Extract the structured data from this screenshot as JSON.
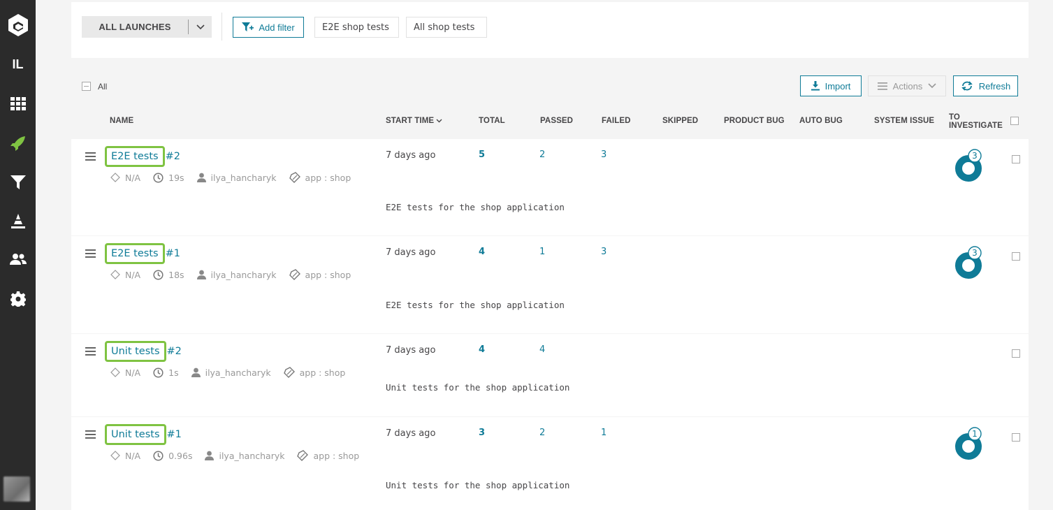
{
  "sidebar": {
    "project_badge": "IL",
    "icons": [
      "logo-icon",
      "project-badge",
      "dashboard-icon",
      "launches-icon",
      "filters-icon",
      "debug-icon",
      "members-icon",
      "settings-icon"
    ]
  },
  "filters": {
    "launch_select": "ALL LAUNCHES",
    "add_filter": "Add filter",
    "tabs": [
      "E2E shop tests",
      "All shop tests"
    ]
  },
  "toolbar": {
    "all_label": "All",
    "import_label": "Import",
    "actions_label": "Actions",
    "refresh_label": "Refresh"
  },
  "columns": {
    "name": "NAME",
    "start_time": "START TIME",
    "total": "TOTAL",
    "passed": "PASSED",
    "failed": "FAILED",
    "skipped": "SKIPPED",
    "product_bug": "PRODUCT BUG",
    "auto_bug": "AUTO BUG",
    "system_issue": "SYSTEM ISSUE",
    "to_investigate_line1": "TO",
    "to_investigate_line2": "INVESTIGATE"
  },
  "colors": {
    "accent": "#0f7b97",
    "highlight": "#7fc342",
    "sidebar": "#2b2b2b"
  },
  "launches": [
    {
      "name": "E2E tests",
      "number": "#2",
      "owner_na": "N/A",
      "duration": "19s",
      "owner": "ilya_hancharyk",
      "attribute": "app : shop",
      "start_time": "7 days ago",
      "total": "5",
      "passed": "2",
      "failed": "3",
      "to_investigate": "3",
      "description": "E2E tests for the shop application"
    },
    {
      "name": "E2E tests",
      "number": "#1",
      "owner_na": "N/A",
      "duration": "18s",
      "owner": "ilya_hancharyk",
      "attribute": "app : shop",
      "start_time": "7 days ago",
      "total": "4",
      "passed": "1",
      "failed": "3",
      "to_investigate": "3",
      "description": "E2E tests for the shop application"
    },
    {
      "name": "Unit tests",
      "number": "#2",
      "owner_na": "N/A",
      "duration": "1s",
      "owner": "ilya_hancharyk",
      "attribute": "app : shop",
      "start_time": "7 days ago",
      "total": "4",
      "passed": "4",
      "failed": "",
      "to_investigate": "",
      "description": "Unit tests for the shop application"
    },
    {
      "name": "Unit tests",
      "number": "#1",
      "owner_na": "N/A",
      "duration": "0.96s",
      "owner": "ilya_hancharyk",
      "attribute": "app : shop",
      "start_time": "7 days ago",
      "total": "3",
      "passed": "2",
      "failed": "1",
      "to_investigate": "1",
      "description": "Unit tests for the shop application"
    }
  ]
}
